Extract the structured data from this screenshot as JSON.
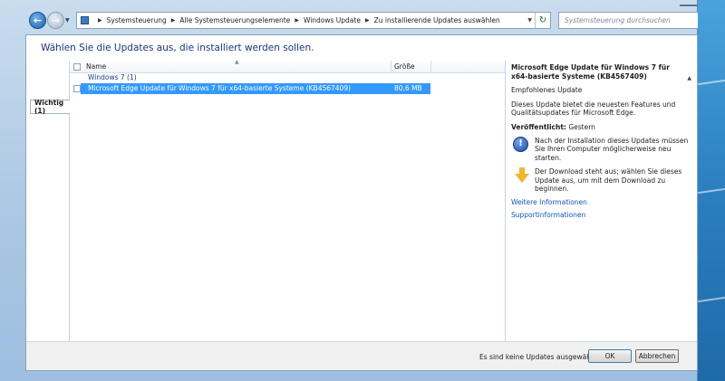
{
  "nav": {
    "breadcrumbs": [
      "Systemsteuerung",
      "Alle Systemsteuerungselemente",
      "Windows Update",
      "Zu installierende Updates auswählen"
    ],
    "search_placeholder": "Systemsteuerung durchsuchen"
  },
  "page": {
    "title": "Wählen Sie die Updates aus, die installiert werden sollen."
  },
  "categories": [
    {
      "label": "Wichtig (1)"
    }
  ],
  "list": {
    "columns": {
      "name": "Name",
      "size": "Größe"
    },
    "group": "Windows 7 (1)",
    "rows": [
      {
        "name": "Microsoft Edge Update für Windows 7 für x64-basierte Systeme (KB4567409)",
        "size": "80,6 MB",
        "selected": true,
        "checked": false
      }
    ]
  },
  "details": {
    "title": "Microsoft Edge Update für Windows 7 für x64-basierte Systeme (KB4567409)",
    "type": "Empfohlenes Update",
    "description": "Dieses Update bietet die neuesten Features und Qualitätsupdates für Microsoft Edge.",
    "released_label": "Veröffentlicht:",
    "released_value": "Gestern",
    "notes": [
      {
        "icon": "restart-icon",
        "text": "Nach der Installation dieses Updates müssen Sie Ihren Computer möglicherweise neu starten."
      },
      {
        "icon": "download-icon",
        "text": "Der Download steht aus; wählen Sie dieses Update aus, um mit dem Download zu beginnen."
      }
    ],
    "links": [
      "Weitere Informationen",
      "Supportinformationen"
    ]
  },
  "footer": {
    "status": "Es sind keine Updates ausgewählt.",
    "ok_label": "OK",
    "cancel_label": "Abbrechen"
  },
  "colors": {
    "selection": "#3399ff",
    "header_text": "#1e3287",
    "link": "#1155cc"
  }
}
